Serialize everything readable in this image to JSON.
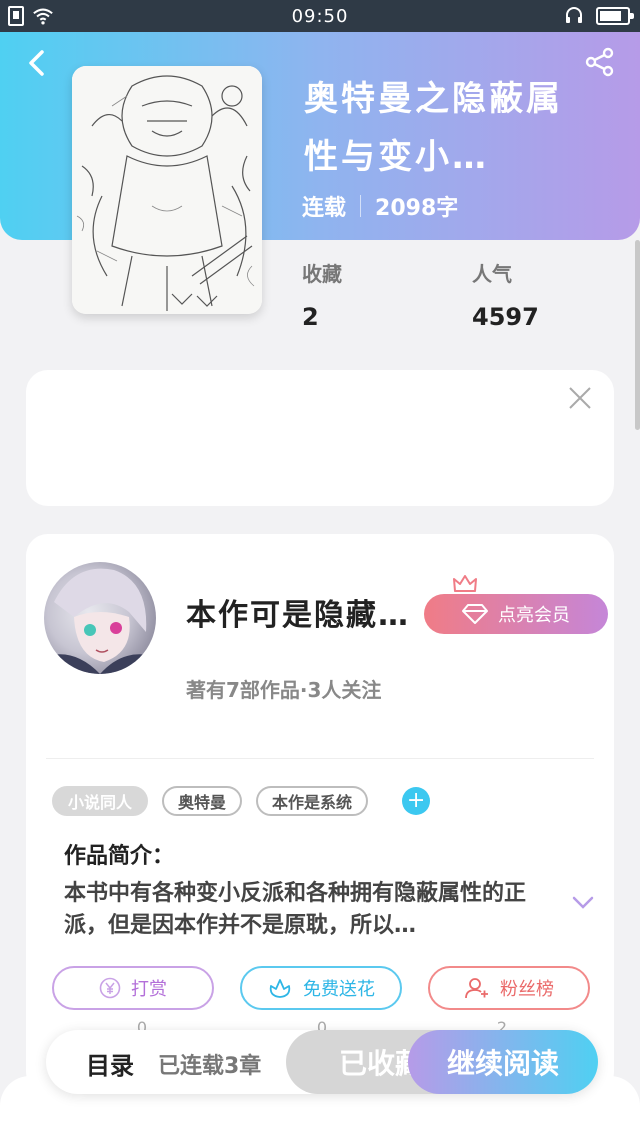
{
  "status_bar": {
    "time": "09:50"
  },
  "book": {
    "title": "奥特曼之隐蔽属性与变小…",
    "status": "连载",
    "word_count": "2098字",
    "stats": [
      {
        "label": "收藏",
        "value": "2"
      },
      {
        "label": "人气",
        "value": "4597"
      }
    ]
  },
  "author": {
    "name": "本作可是隐藏…",
    "vip_button": "点亮会员",
    "subtitle": "著有7部作品·3人关注"
  },
  "tags": [
    "小说同人",
    "奥特曼",
    "本作是系统"
  ],
  "intro": {
    "title": "作品简介：",
    "text": "本书中有各种变小反派和各种拥有隐蔽属性的正派，但是因本作并不是原耽，所以…"
  },
  "actions": [
    {
      "label": "打赏",
      "icon": "yen-icon",
      "count": "0"
    },
    {
      "label": "免费送花",
      "icon": "flower-icon",
      "count": "0"
    },
    {
      "label": "粉丝榜",
      "icon": "user-icon",
      "count": "2"
    }
  ],
  "bottom_bar": {
    "toc": "目录",
    "serial": "已连载3章",
    "collected": "已收藏",
    "continue": "继续阅读"
  },
  "colors": {
    "header_start": "#4fd0f2",
    "header_end": "#b69be8",
    "vip_start": "#f07c86",
    "vip_end": "#c586d8"
  }
}
